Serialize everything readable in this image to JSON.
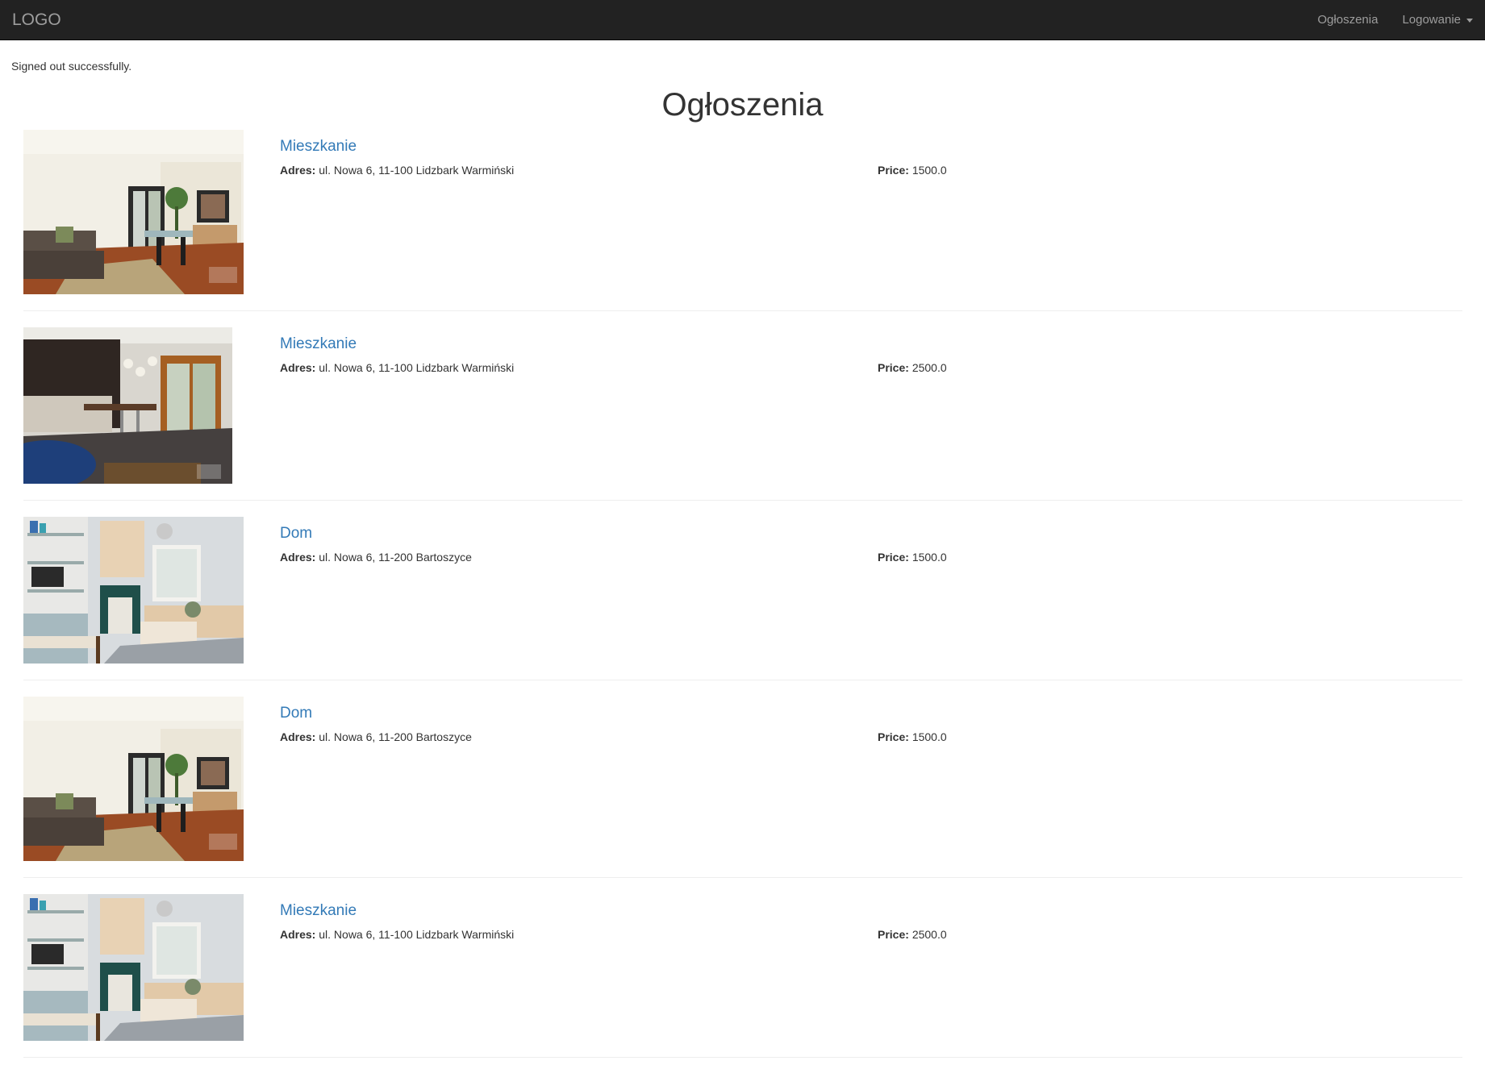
{
  "navbar": {
    "brand": "LOGO",
    "links": [
      {
        "label": "Ogłoszenia"
      },
      {
        "label": "Logowanie"
      }
    ]
  },
  "flash": "Signed out successfully.",
  "page_title": "Ogłoszenia",
  "labels": {
    "address": "Adres:",
    "price": "Price:"
  },
  "listings": [
    {
      "title": "Mieszkanie",
      "address": "ul. Nowa 6, 11-100 Lidzbark Warmiński",
      "price": "1500.0",
      "photo": "living-room-photo"
    },
    {
      "title": "Mieszkanie",
      "address": "ul. Nowa 6, 11-100 Lidzbark Warmiński",
      "price": "2500.0",
      "photo": "kitchen-photo"
    },
    {
      "title": "Dom",
      "address": "ul. Nowa 6, 11-200 Bartoszyce",
      "price": "1500.0",
      "photo": "lounge-photo"
    },
    {
      "title": "Dom",
      "address": "ul. Nowa 6, 11-200 Bartoszyce",
      "price": "1500.0",
      "photo": "living-room-photo"
    },
    {
      "title": "Mieszkanie",
      "address": "ul. Nowa 6, 11-100 Lidzbark Warmiński",
      "price": "2500.0",
      "photo": "lounge-photo"
    }
  ]
}
